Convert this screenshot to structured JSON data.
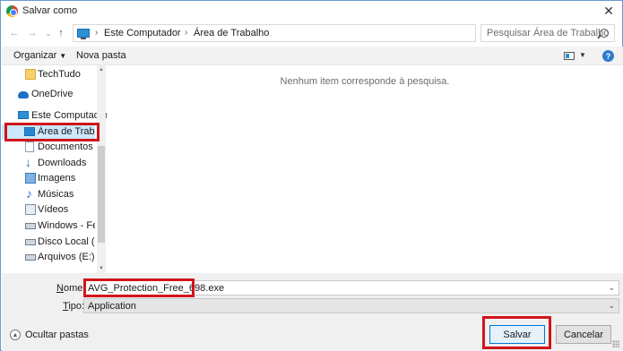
{
  "window": {
    "title": "Salvar como",
    "close_glyph": "✕"
  },
  "nav": {
    "back_glyph": "←",
    "forward_glyph": "→",
    "up_dropdown_glyph": "⌄",
    "up_glyph": "↑"
  },
  "address": {
    "sep1": "›",
    "crumb1": "Este Computador",
    "sep2": "›",
    "crumb2": "Área de Trabalho",
    "dropdown_glyph": "⌄",
    "refresh_glyph": "↻"
  },
  "search": {
    "placeholder": "Pesquisar Área de Trabalho"
  },
  "toolbar": {
    "organize_label": "Organizar",
    "organize_caret": "▼",
    "new_folder_label": "Nova pasta",
    "view_dropdown_glyph": "▼",
    "help_glyph": "?"
  },
  "sidebar": {
    "items": [
      {
        "label": "TechTudo",
        "icon": "folder-icon"
      },
      {
        "label": "OneDrive",
        "icon": "cloud-icon"
      },
      {
        "label": "Este Computador",
        "icon": "computer-icon"
      },
      {
        "label": "Área de Trabalho",
        "icon": "desktop-icon",
        "selected": true
      },
      {
        "label": "Documentos",
        "icon": "documents-icon"
      },
      {
        "label": "Downloads",
        "icon": "downloads-icon"
      },
      {
        "label": "Imagens",
        "icon": "images-icon"
      },
      {
        "label": "Músicas",
        "icon": "music-icon"
      },
      {
        "label": "Vídeos",
        "icon": "videos-icon"
      },
      {
        "label": "Windows - Felip",
        "icon": "drive-icon"
      },
      {
        "label": "Disco Local (D:)",
        "icon": "drive-icon"
      },
      {
        "label": "Arquivos (E:)",
        "icon": "drive-icon"
      }
    ],
    "scroll_up_glyph": "▲",
    "scroll_down_glyph": "▼"
  },
  "content": {
    "empty_message": "Nenhum item corresponde à pesquisa."
  },
  "form": {
    "name_label_key": "N",
    "name_label_rest": "ome:",
    "name_value": "AVG_Protection_Free_698.exe",
    "name_dropdown_glyph": "⌄",
    "type_label_key": "T",
    "type_label_rest": "ipo:",
    "type_value": "Application",
    "type_dropdown_glyph": "⌄"
  },
  "footer": {
    "hide_folders_glyph": "▲",
    "hide_folders_label": "Ocultar pastas",
    "save_label": "Salvar",
    "cancel_label": "Cancelar"
  },
  "colors": {
    "accent": "#0078d7",
    "highlight_red": "#d0151a",
    "selected_bg": "#cce8ff"
  }
}
